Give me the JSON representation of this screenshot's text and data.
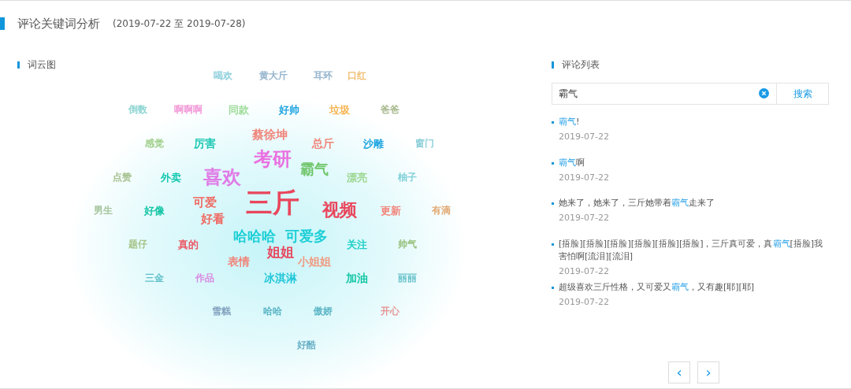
{
  "header": {
    "title": "评论关键词分析",
    "date_range": "(2019-07-22 至 2019-07-28)"
  },
  "word_cloud": {
    "title": "词云图",
    "words": [
      {
        "text": "喝欢",
        "color": "#8fd0dc"
      },
      {
        "text": "黄大斤",
        "color": "#94b4cc"
      },
      {
        "text": "耳环",
        "color": "#94b4cc"
      },
      {
        "text": "口红",
        "color": "#efbf72"
      },
      {
        "text": "倒数",
        "color": "#8ed5d3"
      },
      {
        "text": "啊啊啊",
        "color": "#f29ad8"
      },
      {
        "text": "同款",
        "color": "#9fdc9a"
      },
      {
        "text": "好帅",
        "color": "#1fa4e0"
      },
      {
        "text": "垃圾",
        "color": "#f5b452"
      },
      {
        "text": "爸爸",
        "color": "#a8b98e"
      },
      {
        "text": "蔡徐坤",
        "color": "#f0857a"
      },
      {
        "text": "感觉",
        "color": "#9fcf8a"
      },
      {
        "text": "厉害",
        "color": "#1fc8b4"
      },
      {
        "text": "总斤",
        "color": "#f0857a"
      },
      {
        "text": "沙雕",
        "color": "#1fa4e0"
      },
      {
        "text": "窗门",
        "color": "#8ccfd8"
      },
      {
        "text": "考研",
        "color": "#ea70e0"
      },
      {
        "text": "霸气",
        "color": "#6fc66a"
      },
      {
        "text": "点赞",
        "color": "#a4c08c"
      },
      {
        "text": "外卖",
        "color": "#14c8b0"
      },
      {
        "text": "喜欢",
        "color": "#e07ae6"
      },
      {
        "text": "漂亮",
        "color": "#9bd68e"
      },
      {
        "text": "柚子",
        "color": "#7fd0d8"
      },
      {
        "text": "男生",
        "color": "#a3c49c"
      },
      {
        "text": "好像",
        "color": "#16c6a6"
      },
      {
        "text": "可爱",
        "color": "#ef6a62"
      },
      {
        "text": "三斤",
        "color": "#e8465c"
      },
      {
        "text": "视频",
        "color": "#e8465c"
      },
      {
        "text": "更新",
        "color": "#f2857a"
      },
      {
        "text": "有滴",
        "color": "#e0a872"
      },
      {
        "text": "好看",
        "color": "#ef6a62"
      },
      {
        "text": "哈哈哈",
        "color": "#1ecfd6"
      },
      {
        "text": "可爱多",
        "color": "#1ecfd6"
      },
      {
        "text": "题仔",
        "color": "#a5c488"
      },
      {
        "text": "真的",
        "color": "#ea5a66"
      },
      {
        "text": "关注",
        "color": "#22d0c8"
      },
      {
        "text": "帅气",
        "color": "#98c07e"
      },
      {
        "text": "姐姐",
        "color": "#e8465c"
      },
      {
        "text": "表情",
        "color": "#f0857a"
      },
      {
        "text": "小姐姐",
        "color": "#f09a80"
      },
      {
        "text": "三金",
        "color": "#5fbfc9"
      },
      {
        "text": "作品",
        "color": "#d98ae2"
      },
      {
        "text": "冰淇淋",
        "color": "#20c6d8"
      },
      {
        "text": "加油",
        "color": "#16c6a6"
      },
      {
        "text": "丽丽",
        "color": "#6cc4cc"
      },
      {
        "text": "雪糕",
        "color": "#7f9fbd"
      },
      {
        "text": "哈哈",
        "color": "#58b4c4"
      },
      {
        "text": "傲娇",
        "color": "#58b4c4"
      },
      {
        "text": "开心",
        "color": "#e59494"
      },
      {
        "text": "好酷",
        "color": "#6cb2c8"
      }
    ]
  },
  "comments": {
    "title": "评论列表",
    "search": {
      "value": "霸气",
      "button": "搜索"
    },
    "items": [
      {
        "parts": [
          {
            "text": "霸气",
            "highlight": true
          },
          {
            "text": "!",
            "highlight": false
          }
        ],
        "date": "2019-07-22"
      },
      {
        "parts": [
          {
            "text": "霸气",
            "highlight": true
          },
          {
            "text": "啊",
            "highlight": false
          }
        ],
        "date": "2019-07-22"
      },
      {
        "parts": [
          {
            "text": "她来了，她来了，三斤她带着",
            "highlight": false
          },
          {
            "text": "霸气",
            "highlight": true
          },
          {
            "text": "走来了",
            "highlight": false
          }
        ],
        "date": "2019-07-22"
      },
      {
        "parts": [
          {
            "text": "[捂脸][捂脸][捂脸][捂脸][捂脸][捂脸]，三斤真可爱，真",
            "highlight": false
          },
          {
            "text": "霸气",
            "highlight": true
          },
          {
            "text": "[捂脸]我害怕啊[流泪][流泪]",
            "highlight": false
          }
        ],
        "date": "2019-07-22"
      },
      {
        "parts": [
          {
            "text": "超级喜欢三斤性格，又可爱又",
            "highlight": false
          },
          {
            "text": "霸气",
            "highlight": true
          },
          {
            "text": "，又有趣[耶][耶]",
            "highlight": false
          }
        ],
        "date": "2019-07-22"
      }
    ],
    "pagination": {
      "prev": "‹",
      "next": "›"
    }
  }
}
